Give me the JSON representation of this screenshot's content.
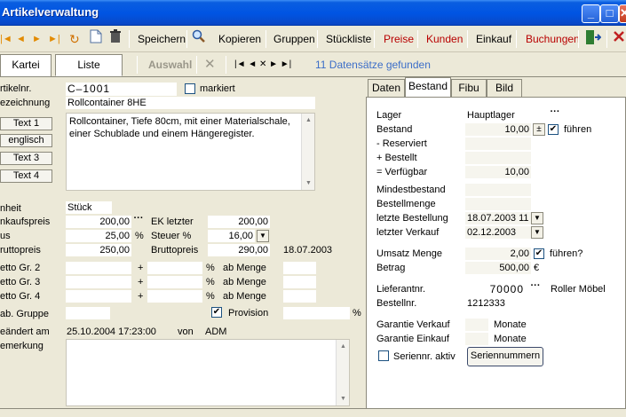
{
  "window": {
    "title": "Artikelverwaltung"
  },
  "toolbar": {
    "speichern": "Speichern",
    "kopieren": "Kopieren",
    "gruppen": "Gruppen",
    "stueckliste": "Stückliste",
    "preise": "Preise",
    "kunden": "Kunden",
    "einkauf": "Einkauf",
    "buchungen": "Buchungen",
    "nav_first": "◄◄",
    "nav_prev": "◄",
    "nav_next": "►",
    "nav_last": "►►",
    "refresh": "↻"
  },
  "tabs": {
    "kartei": "Kartei",
    "liste": "Liste",
    "auswahl": "Auswahl",
    "nav": "|◄ ◄ ✕ ► ►|",
    "status": "11 Datensätze gefunden"
  },
  "left": {
    "artikelnr_label": "rtikelnr.",
    "artikelnr": "C–1001",
    "markiert_label": "markiert",
    "bezeichnung_label": "ezeichnung",
    "bezeichnung": "Rollcontainer  8HE",
    "text1": "Text 1",
    "englisch": "englisch",
    "text3": "Text 3",
    "text4": "Text 4",
    "beschreibung": "Rollcontainer, Tiefe 80cm, mit einer Materialschale, einer Schublade und einem Hängeregister.",
    "einheit_label": "nheit",
    "einheit": "Stück",
    "ekpreis_label": "nkaufspreis",
    "ekpreis": "200,00",
    "plus_label": "us",
    "plus": "25,00",
    "pct": "%",
    "bruttopreis_label": "ruttopreis",
    "bruttopreis": "250,00",
    "ek_letzter_label": "EK letzter",
    "ek_letzter": "200,00",
    "steuer_label": "Steuer %",
    "steuer": "16,00",
    "bruttopreis2_label": "Bruttopreis",
    "bruttopreis2": "290,00",
    "datum": "18.07.2003",
    "netto2": "etto Gr. 2",
    "netto3": "etto Gr. 3",
    "netto4": "etto Gr. 4",
    "plus_sign": "+",
    "ab_menge": "ab Menge",
    "rab_gruppe": "ab. Gruppe",
    "provision": "Provision",
    "geaendert_label": "eändert am",
    "geaendert": "25.10.2004 17:23:00",
    "von": "von",
    "user": "ADM",
    "bemerkung": "emerkung"
  },
  "right": {
    "tabs": [
      "Daten",
      "Bestand",
      "Fibu",
      "Bild"
    ],
    "lager_label": "Lager",
    "lager": "Hauptlager",
    "bestand_label": "Bestand",
    "bestand": "10,00",
    "pm": "±",
    "fuehren": "führen",
    "reserviert": "- Reserviert",
    "bestellt": "+ Bestellt",
    "verfuegbar_label": "= Verfügbar",
    "verfuegbar": "10,00",
    "mindestbestand": "Mindestbestand",
    "bestellmenge": "Bestellmenge",
    "letzte_bestellung_label": "letzte Bestellung",
    "letzte_bestellung": "18.07.2003 11",
    "letzter_verkauf_label": "letzter Verkauf",
    "letzter_verkauf": "02.12.2003",
    "umsatz_label": "Umsatz Menge",
    "umsatz": "2,00",
    "fuehren2": "führen?",
    "betrag_label": "Betrag",
    "betrag": "500,00",
    "euro": "€",
    "lieferant_label": "Lieferantnr.",
    "lieferant": "70000",
    "lieferant_name": "Roller Möbel",
    "bestellnr_label": "Bestellnr.",
    "bestellnr": "1212333",
    "garantie_vk": "Garantie Verkauf",
    "garantie_ek": "Garantie Einkauf",
    "monate": "Monate",
    "seriennr_aktiv": "Seriennr. aktiv",
    "seriennummern": "Seriennummern"
  }
}
